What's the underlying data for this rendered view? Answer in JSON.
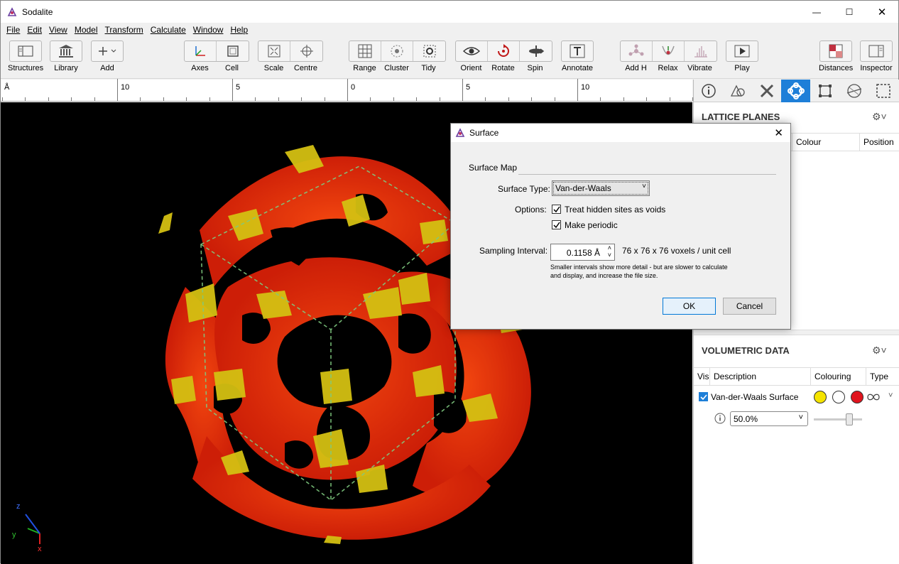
{
  "window": {
    "title": "Sodalite",
    "minimize": "—",
    "maximize": "☐",
    "close": "✕"
  },
  "menu": [
    "File",
    "Edit",
    "View",
    "Model",
    "Transform",
    "Calculate",
    "Window",
    "Help"
  ],
  "toolbar": {
    "structures": "Structures",
    "library": "Library",
    "add": "Add",
    "axes": "Axes",
    "cell": "Cell",
    "scale": "Scale",
    "centre": "Centre",
    "range": "Range",
    "cluster": "Cluster",
    "tidy": "Tidy",
    "orient": "Orient",
    "rotate": "Rotate",
    "spin": "Spin",
    "annotate": "Annotate",
    "add_h": "Add H",
    "relax": "Relax",
    "vibrate": "Vibrate",
    "play": "Play",
    "distances": "Distances",
    "inspector": "Inspector"
  },
  "ruler": {
    "unit": "Å",
    "labels": [
      "10",
      "5",
      "0",
      "5",
      "10"
    ]
  },
  "axes_legend": {
    "z": "z",
    "y": "y",
    "x": "x"
  },
  "lattice_planes": {
    "title": "LATTICE PLANES",
    "col_colour": "Colour",
    "col_position": "Position"
  },
  "volumetric": {
    "title": "VOLUMETRIC DATA",
    "col_vis": "Vis",
    "col_description": "Description",
    "col_colouring": "Colouring",
    "col_type": "Type",
    "row_description": "Van-der-Waals Surface",
    "opacity": "50.0%",
    "colors": [
      "#f5e400",
      "#ffffff",
      "#e0141e"
    ]
  },
  "dialog": {
    "title": "Surface",
    "section": "Surface Map",
    "surface_type_label": "Surface Type:",
    "surface_type_value": "Van-der-Waals",
    "options_label": "Options:",
    "opt_hidden": "Treat hidden sites as voids",
    "opt_periodic": "Make periodic",
    "sampling_label": "Sampling Interval:",
    "sampling_value": "0.1158 Å",
    "voxels": "76 x 76 x 76 voxels / unit cell",
    "hint_line1": "Smaller intervals show more detail - but are slower to calculate",
    "hint_line2": "and display, and increase the file size.",
    "ok": "OK",
    "cancel": "Cancel"
  },
  "accent": "#1e7fd8"
}
